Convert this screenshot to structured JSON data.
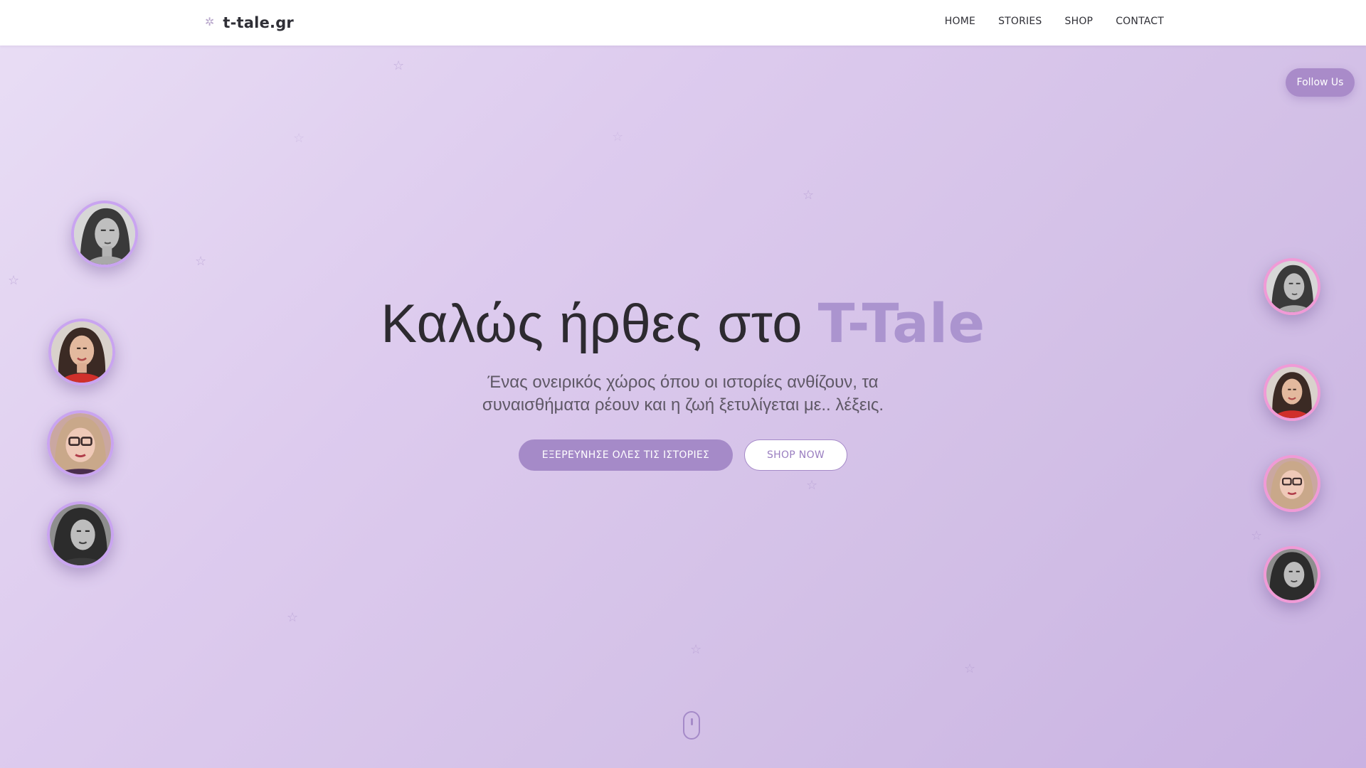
{
  "header": {
    "brand_icon": "sparkle-icon",
    "brand_name": "t-tale.gr",
    "nav": [
      {
        "label": "HOME"
      },
      {
        "label": "STORIES"
      },
      {
        "label": "SHOP"
      },
      {
        "label": "CONTACT"
      }
    ]
  },
  "follow_button": {
    "label": "Follow Us"
  },
  "hero": {
    "title_prefix": "Καλώς ήρθες στο ",
    "title_accent": "T-Tale",
    "subtitle": "Ένας ονειρικός χώρος όπου οι ιστορίες ανθίζουν, τα συναισθήματα ρέουν και η ζωή ξετυλίγεται με.. λέξεις.",
    "primary_cta": "ΕΞΕΡΕΥΝΗΣΕ ΟΛΕΣ ΤΙΣ ΙΣΤΟΡΙΕΣ",
    "secondary_cta": "SHOP NOW"
  },
  "colors": {
    "accent": "#a58ac8",
    "title_accent": "#ab94cf",
    "left_ring": "#c9a4f0",
    "right_ring": "#f09ad6",
    "background_start": "#e9def5",
    "background_end": "#c9b2e2"
  },
  "icons": {
    "decor_star": "star-outline-icon",
    "scroll_indicator": "mouse-scroll-icon"
  }
}
